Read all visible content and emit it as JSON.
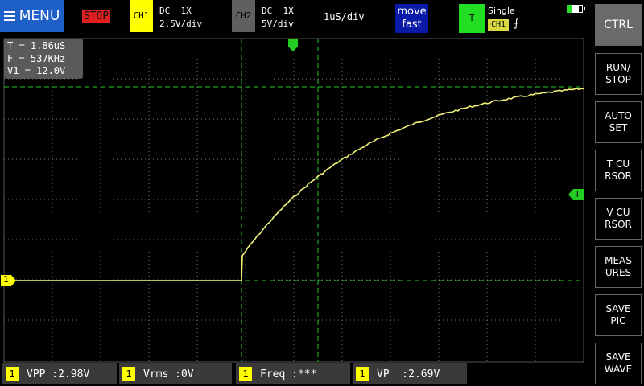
{
  "top_bar": {
    "menu_label": "MENU",
    "run_state": "STOP",
    "ch1": {
      "badge": "CH1",
      "coupling": "DC  1X",
      "scale": "2.5V/div"
    },
    "ch2": {
      "badge": "CH2",
      "coupling": "DC  1X",
      "scale": "5V/div"
    },
    "timebase": "1uS/div",
    "move_line1": "move",
    "move_line2": "fast",
    "trigger": {
      "badge": "T",
      "mode": "Single",
      "source": "CH1",
      "edge_symbol": "⨍"
    }
  },
  "info_box": {
    "period": "T = 1.86uS",
    "frequency": "F = 537KHz",
    "voltage": "V1 = 12.0V"
  },
  "side_buttons": {
    "ctrl": "CTRL",
    "run_stop": "RUN/\nSTOP",
    "auto_set": "AUTO\nSET",
    "t_cursor": "T CU\nRSOR",
    "v_cursor": "V CU\nRSOR",
    "measures": "MEAS\nURES",
    "save_pic": "SAVE\nPIC",
    "save_wave": "SAVE\nWAVE"
  },
  "markers": {
    "ch1_marker": "1",
    "trigger_level_marker": "T"
  },
  "measurements": [
    {
      "channel": "1",
      "text": "VPP :2.98V"
    },
    {
      "channel": "1",
      "text": "Vrms :0V"
    },
    {
      "channel": "1",
      "text": "Freq :***"
    },
    {
      "channel": "1",
      "text": "VP  :2.69V"
    }
  ],
  "colors": {
    "ch1": "#ffff00",
    "trace": "#f2f27a",
    "grid": "#777777",
    "cursor": "#22cc22",
    "menu": "#1f5fc8",
    "stop": "#e02020",
    "trigger": "#22dd22"
  }
}
